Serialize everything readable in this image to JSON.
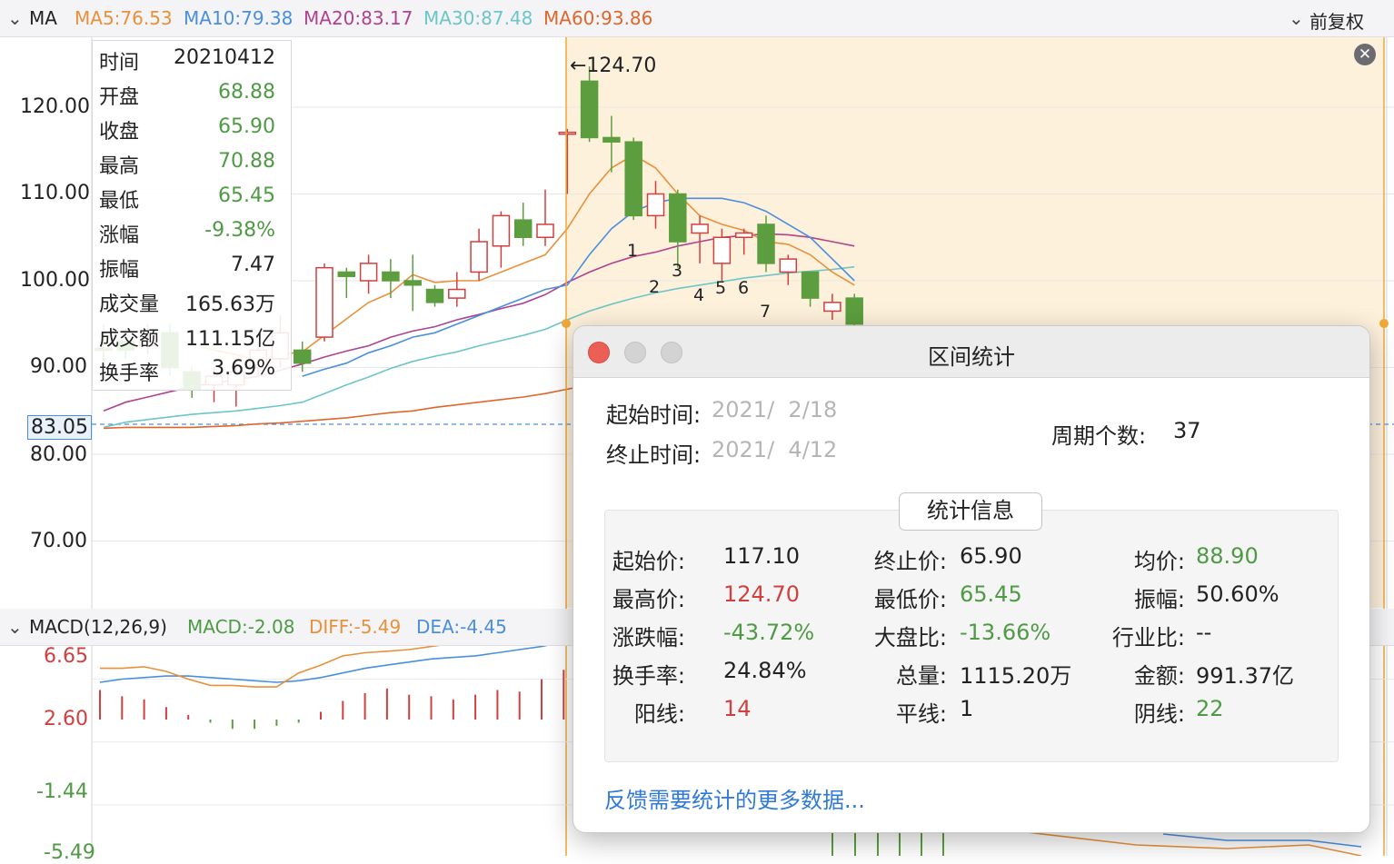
{
  "ma_bar": {
    "label": "MA",
    "ma5": "MA5:76.53",
    "ma10": "MA10:79.38",
    "ma20": "MA20:83.17",
    "ma30": "MA30:87.48",
    "ma60": "MA60:93.86",
    "adjust": "前复权"
  },
  "macd_bar": {
    "label": "MACD(12,26,9)",
    "macd": "MACD:-2.08",
    "diff": "DIFF:-5.49",
    "dea": "DEA:-4.45"
  },
  "price_axis": [
    "120.00",
    "110.00",
    "100.00",
    "90.00",
    "80.00",
    "70.00"
  ],
  "current_price": "83.05",
  "peak_label": "←124.70",
  "macd_axis": [
    "6.65",
    "2.60",
    "-1.44",
    "-5.49"
  ],
  "candle_marks": [
    "1",
    "2",
    "3",
    "4",
    "5",
    "6",
    "7"
  ],
  "tooltip": [
    {
      "k": "时间",
      "v": "20210412"
    },
    {
      "k": "开盘",
      "v": "68.88"
    },
    {
      "k": "收盘",
      "v": "65.90"
    },
    {
      "k": "最高",
      "v": "70.88"
    },
    {
      "k": "最低",
      "v": "65.45"
    },
    {
      "k": "涨幅",
      "v": "-9.38%"
    },
    {
      "k": "振幅",
      "v": "7.47"
    },
    {
      "k": "成交量",
      "v": "165.63万"
    },
    {
      "k": "成交额",
      "v": "111.15亿"
    },
    {
      "k": "换手率",
      "v": "3.69%"
    }
  ],
  "dialog": {
    "title": "区间统计",
    "start_label": "起始时间:",
    "start_value": "2021/  2/18",
    "end_label": "终止时间:",
    "end_value": "2021/  4/12",
    "period_label": "周期个数:",
    "period_value": "37",
    "section": "统计信息",
    "stats": {
      "start_price": {
        "k": "起始价:",
        "v": "117.10"
      },
      "end_price": {
        "k": "终止价:",
        "v": "65.90"
      },
      "avg_price": {
        "k": "均价:",
        "v": "88.90"
      },
      "high_price": {
        "k": "最高价:",
        "v": "124.70"
      },
      "low_price": {
        "k": "最低价:",
        "v": "65.45"
      },
      "amplitude": {
        "k": "振幅:",
        "v": "50.60%"
      },
      "change": {
        "k": "涨跌幅:",
        "v": "-43.72%"
      },
      "market_ratio": {
        "k": "大盘比:",
        "v": "-13.66%"
      },
      "industry_ratio": {
        "k": "行业比:",
        "v": "--"
      },
      "turnover": {
        "k": "换手率:",
        "v": "24.84%"
      },
      "volume": {
        "k": "总量:",
        "v": "1115.20万"
      },
      "amount": {
        "k": "金额:",
        "v": "991.37亿"
      },
      "up_days": {
        "k": "阳线:",
        "v": "14"
      },
      "flat_days": {
        "k": "平线:",
        "v": "1"
      },
      "down_days": {
        "k": "阴线:",
        "v": "22"
      }
    },
    "feedback": "反馈需要统计的更多数据..."
  },
  "colors": {
    "up": "#d13f3f",
    "down": "#5c9e3f",
    "ma5": "#e8913a",
    "ma10": "#4a8fde",
    "ma20": "#b0428e",
    "ma30": "#6cc6c8",
    "ma60": "#e0662c",
    "selection": "#fdf1dc",
    "selection_edge": "#f0a838"
  },
  "chart_data": {
    "type": "candlestick",
    "price_range": [
      63,
      128
    ],
    "candles": [
      {
        "o": 92.2,
        "c": 92.0,
        "h": 95.0,
        "l": 90.5
      },
      {
        "o": 93.0,
        "c": 92.0,
        "h": 94.5,
        "l": 91.0
      },
      {
        "o": 92.5,
        "c": 93.0,
        "h": 95.0,
        "l": 91.5
      },
      {
        "o": 94.0,
        "c": 90.0,
        "h": 95.0,
        "l": 89.0
      },
      {
        "o": 89.5,
        "c": 87.5,
        "h": 90.0,
        "l": 86.5
      },
      {
        "o": 88.0,
        "c": 89.0,
        "h": 90.0,
        "l": 86.0
      },
      {
        "o": 88.0,
        "c": 89.5,
        "h": 91.0,
        "l": 85.5
      },
      {
        "o": 90.0,
        "c": 92.0,
        "h": 93.0,
        "l": 89.0
      },
      {
        "o": 91.0,
        "c": 94.0,
        "h": 96.0,
        "l": 90.0
      },
      {
        "o": 92.0,
        "c": 90.5,
        "h": 93.0,
        "l": 89.5
      },
      {
        "o": 93.5,
        "c": 101.5,
        "h": 102.0,
        "l": 93.0
      },
      {
        "o": 101.0,
        "c": 100.5,
        "h": 101.5,
        "l": 98.0
      },
      {
        "o": 100.0,
        "c": 102.0,
        "h": 103.0,
        "l": 98.5
      },
      {
        "o": 101.0,
        "c": 100.0,
        "h": 102.5,
        "l": 98.0
      },
      {
        "o": 100.0,
        "c": 99.5,
        "h": 103.0,
        "l": 96.5
      },
      {
        "o": 99.0,
        "c": 97.5,
        "h": 99.5,
        "l": 97.0
      },
      {
        "o": 98.0,
        "c": 99.0,
        "h": 101.0,
        "l": 97.0
      },
      {
        "o": 101.0,
        "c": 104.5,
        "h": 106.0,
        "l": 100.0
      },
      {
        "o": 104.0,
        "c": 107.5,
        "h": 108.0,
        "l": 101.5
      },
      {
        "o": 107.0,
        "c": 105.0,
        "h": 109.0,
        "l": 104.0
      },
      {
        "o": 105.0,
        "c": 106.5,
        "h": 110.5,
        "l": 104.0
      },
      {
        "o": 117.0,
        "c": 117.1,
        "h": 117.5,
        "l": 110.0
      },
      {
        "o": 123.0,
        "c": 116.5,
        "h": 124.7,
        "l": 116.0
      },
      {
        "o": 116.5,
        "c": 116.0,
        "h": 119.0,
        "l": 112.5
      },
      {
        "o": 116.0,
        "c": 107.5,
        "h": 116.5,
        "l": 107.0
      },
      {
        "o": 107.5,
        "c": 110.0,
        "h": 111.5,
        "l": 106.0
      },
      {
        "o": 110.0,
        "c": 104.5,
        "h": 110.5,
        "l": 101.5
      },
      {
        "o": 105.5,
        "c": 106.5,
        "h": 107.5,
        "l": 102.0
      },
      {
        "o": 102.0,
        "c": 105.0,
        "h": 106.0,
        "l": 100.0
      },
      {
        "o": 105.0,
        "c": 105.5,
        "h": 106.0,
        "l": 103.0
      },
      {
        "o": 106.5,
        "c": 102.0,
        "h": 107.5,
        "l": 101.0
      },
      {
        "o": 101.0,
        "c": 102.5,
        "h": 103.0,
        "l": 99.5
      },
      {
        "o": 101.0,
        "c": 98.0,
        "h": 101.0,
        "l": 97.0
      },
      {
        "o": 96.5,
        "c": 97.5,
        "h": 98.5,
        "l": 95.5
      },
      {
        "o": 98.0,
        "c": 95.0,
        "h": 98.5,
        "l": 93.0
      }
    ],
    "ma5": [
      null,
      null,
      null,
      null,
      92.8,
      92.0,
      91.5,
      90.8,
      91.5,
      91.8,
      93.7,
      95.6,
      97.5,
      98.6,
      100.7,
      99.8,
      100.0,
      100.0,
      101.0,
      102.0,
      103.0,
      106.0,
      110.0,
      113.0,
      114.5,
      113.0,
      110.0,
      107.5,
      106.5,
      105.8,
      104.5,
      104.2,
      103.0,
      101.0,
      99.5
    ],
    "ma10": [
      null,
      null,
      null,
      null,
      null,
      null,
      null,
      null,
      null,
      89.0,
      89.8,
      90.5,
      91.7,
      92.5,
      93.5,
      94.0,
      95.0,
      96.0,
      97.0,
      98.0,
      99.0,
      99.5,
      103.0,
      106.0,
      108.0,
      109.0,
      109.5,
      109.5,
      109.5,
      109.0,
      108.0,
      106.5,
      105.0,
      102.5,
      100.0
    ],
    "ma20": [
      85.0,
      86.0,
      86.6,
      87.2,
      87.8,
      88.2,
      88.6,
      89.0,
      89.7,
      90.4,
      91.2,
      91.9,
      92.5,
      93.5,
      94.2,
      94.7,
      95.5,
      96.1,
      96.8,
      97.4,
      98.4,
      99.8,
      101.0,
      102.0,
      102.8,
      103.3,
      104.0,
      104.5,
      105.0,
      105.2,
      105.4,
      105.3,
      105.0,
      104.5,
      104.0
    ],
    "ma30": [
      83.1,
      83.7,
      84.0,
      84.3,
      84.6,
      84.8,
      85.0,
      85.3,
      85.6,
      86.0,
      87.0,
      88.0,
      88.9,
      89.9,
      90.7,
      91.3,
      91.8,
      92.5,
      93.1,
      93.7,
      94.4,
      95.5,
      96.5,
      97.3,
      98.0,
      98.6,
      99.1,
      99.5,
      99.9,
      100.3,
      100.6,
      100.9,
      101.1,
      101.3,
      101.6
    ],
    "ma60": [
      83.0,
      83.1,
      83.1,
      83.1,
      83.1,
      83.2,
      83.3,
      83.5,
      83.6,
      83.8,
      84.0,
      84.2,
      84.5,
      84.8,
      85.0,
      85.4,
      85.7,
      86.0,
      86.3,
      86.6,
      87.0,
      87.5,
      88.0,
      88.4,
      88.9,
      89.4,
      89.9,
      90.3,
      90.8,
      91.2,
      91.7,
      92.1,
      92.6,
      93.0,
      93.4
    ],
    "macd_range": [
      -6,
      8
    ],
    "macd_hist": [
      1.9,
      1.5,
      1.3,
      0.8,
      0.3,
      -0.2,
      -0.6,
      -0.6,
      -0.4,
      -0.2,
      0.5,
      1.2,
      1.7,
      2.0,
      1.6,
      1.5,
      1.3,
      1.6,
      1.9,
      1.8,
      2.6,
      3.2,
      4.2
    ],
    "diff": [
      3.3,
      3.3,
      3.4,
      3.1,
      2.6,
      2.2,
      2.2,
      2.1,
      2.1,
      3.0,
      3.5,
      4.1,
      4.3,
      4.4,
      4.5,
      4.7,
      4.9,
      5.0,
      5.1,
      5.3,
      5.4,
      6.2,
      7.2
    ],
    "dea": [
      2.4,
      2.6,
      2.7,
      2.8,
      2.8,
      2.7,
      2.6,
      2.5,
      2.4,
      2.5,
      2.7,
      3.0,
      3.3,
      3.5,
      3.7,
      3.9,
      4.0,
      4.1,
      4.3,
      4.5,
      4.7,
      5.0,
      5.4
    ]
  }
}
